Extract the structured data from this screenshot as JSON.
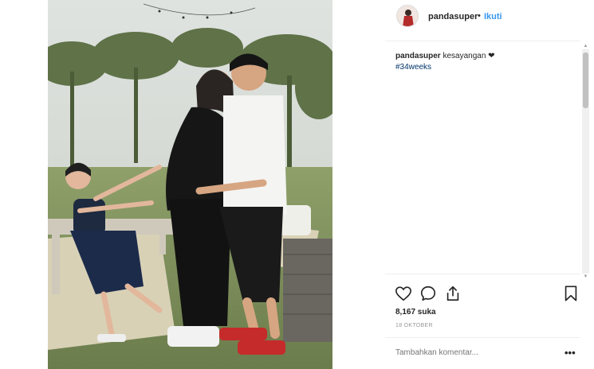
{
  "post": {
    "author": {
      "username": "pandasuper",
      "separator": "•",
      "follow_label": "Ikuti"
    },
    "caption": {
      "username": "pandasuper",
      "text": "kesayangan ❤",
      "hashtag": "#34weeks"
    },
    "likes_text": "8,167 suka",
    "timestamp": "18 OKTOBER",
    "comment_placeholder": "Tambahkan komentar...",
    "more_label": "•••"
  },
  "icons": {
    "like": "heart-icon",
    "comment": "comment-bubble-icon",
    "share": "share-icon",
    "save": "bookmark-icon",
    "more": "more-options-icon"
  },
  "colors": {
    "link_blue": "#3897f0",
    "hashtag_blue": "#003569",
    "text": "#262626",
    "muted": "#999999",
    "divider": "#efefef"
  }
}
